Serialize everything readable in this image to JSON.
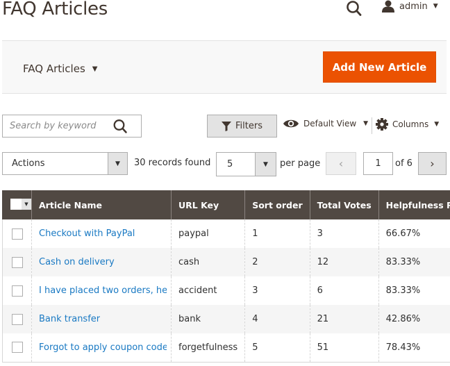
{
  "header": {
    "title": "FAQ Articles",
    "search_icon": "search-icon",
    "user": {
      "icon": "user-icon",
      "name": "admin"
    }
  },
  "action_bar": {
    "switcher_label": "FAQ Articles",
    "add_button_label": "Add New Article",
    "accent_color": "#eb5202"
  },
  "toolbar": {
    "search": {
      "placeholder": "Search by keyword",
      "value": ""
    },
    "filters_label": "Filters",
    "view_label": "Default View",
    "columns_label": "Columns"
  },
  "pagination": {
    "actions_label": "Actions",
    "records_found": "30 records found",
    "per_page_value": "5",
    "per_page_label": "per page",
    "current_page": "1",
    "of_pages": "of 6",
    "prev_symbol": "‹",
    "next_symbol": "›"
  },
  "grid": {
    "columns": [
      "Article Name",
      "URL Key",
      "Sort order",
      "Total Votes",
      "Helpfulness Rate"
    ],
    "rows": [
      {
        "name": "Checkout with PayPal",
        "url_key": "paypal",
        "sort_order": "1",
        "total_votes": "3",
        "rate": "66.67%"
      },
      {
        "name": "Cash on delivery",
        "url_key": "cash",
        "sort_order": "2",
        "total_votes": "12",
        "rate": "83.33%"
      },
      {
        "name": "I have placed two orders, help!",
        "url_key": "accident",
        "sort_order": "3",
        "total_votes": "6",
        "rate": "83.33%"
      },
      {
        "name": "Bank transfer",
        "url_key": "bank",
        "sort_order": "4",
        "total_votes": "21",
        "rate": "42.86%"
      },
      {
        "name": "Forgot to apply coupon code",
        "url_key": "forgetfulness",
        "sort_order": "5",
        "total_votes": "51",
        "rate": "78.43%"
      }
    ]
  }
}
